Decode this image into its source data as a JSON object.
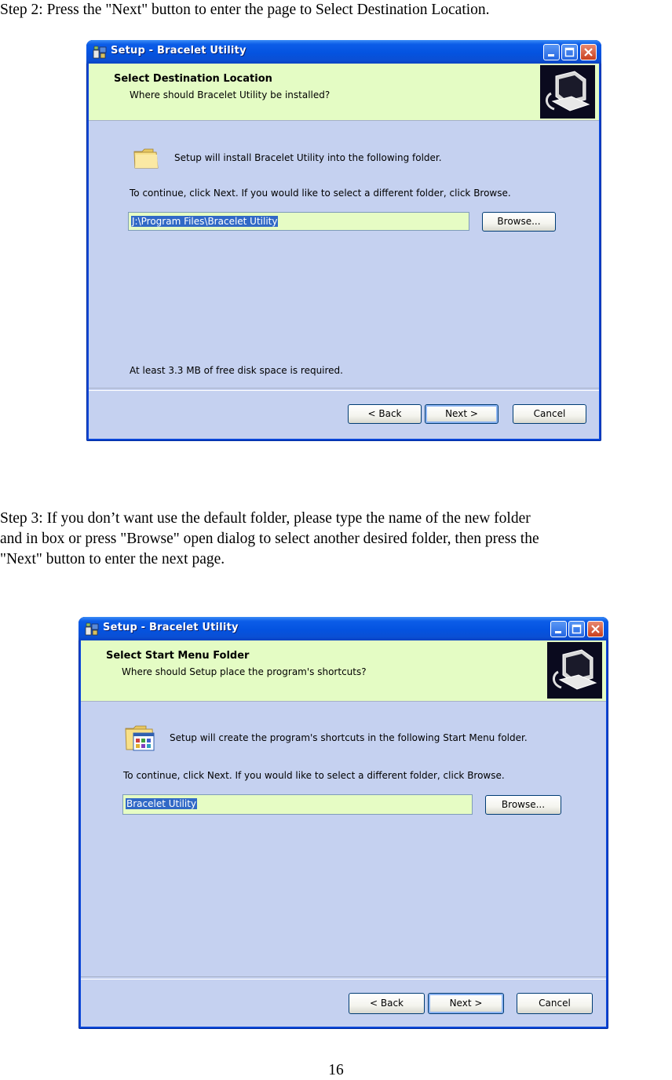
{
  "step2": {
    "text": "Step 2: Press the \"Next\" button to enter the page to Select Destination Location.",
    "dialog": {
      "window_title": "Setup - Bracelet Utility",
      "header_title": "Select Destination Location",
      "header_subtitle": "Where should Bracelet Utility be installed?",
      "intro": "Setup will install Bracelet Utility into the following folder.",
      "instruction": "To continue, click Next. If you would like to select a different folder, click Browse.",
      "path_value": "J:\\Program Files\\Bracelet Utility",
      "browse_label": "Browse...",
      "disk_space": "At least 3.3 MB of free disk space is required.",
      "back_label": "< Back",
      "next_label": "Next >",
      "cancel_label": "Cancel"
    }
  },
  "step3": {
    "line1": "Step 3: If you don’t want use the default folder, please type the name of the new folder",
    "line2": "and in box or press \"Browse\" open dialog to select another desired folder, then press the",
    "line3": "\"Next\" button to enter the next page.",
    "dialog": {
      "window_title": "Setup - Bracelet Utility",
      "header_title": "Select Start Menu Folder",
      "header_subtitle": "Where should Setup place the program's shortcuts?",
      "intro": "Setup will create the program's shortcuts in the following Start Menu folder.",
      "instruction": "To continue, click Next. If you would like to select a different folder, click Browse.",
      "folder_value": "Bracelet Utility",
      "browse_label": "Browse...",
      "back_label": "< Back",
      "next_label": "Next >",
      "cancel_label": "Cancel"
    }
  },
  "page_number": "16",
  "colors": {
    "titlebar": "#0453e0",
    "header_bg": "#e4fcc4",
    "client_bg": "#c5d1f0",
    "selection": "#3169c6"
  },
  "icons": [
    "setup-app-icon",
    "minimize-icon",
    "maximize-icon",
    "close-icon",
    "computer-install-icon",
    "folder-icon",
    "start-menu-folder-icon"
  ]
}
